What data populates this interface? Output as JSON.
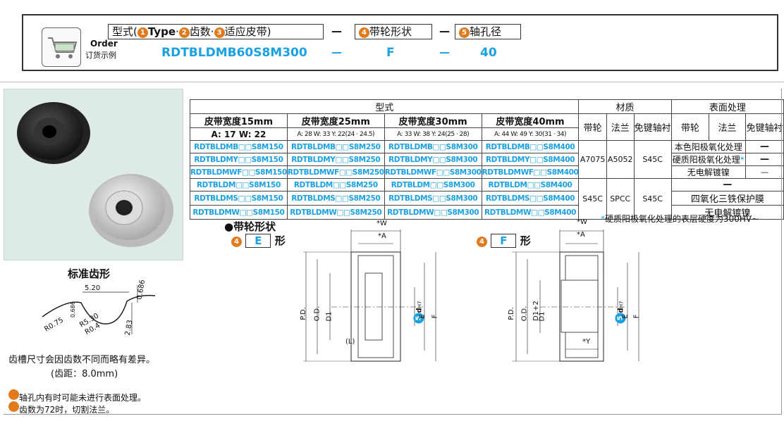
{
  "order": {
    "title_en": "Order",
    "title_cn": "订货示例",
    "type_label_prefix": "型式(",
    "type_label_type": "Type",
    "type_label_dot1": "·",
    "type_label_teeth": "齿数",
    "type_label_dot2": "·",
    "type_label_belt": "适应皮带",
    "type_label_suffix": ")",
    "shape_label": "带轮形状",
    "bore_label": "轴孔径",
    "num1": "1",
    "num2": "2",
    "num3": "3",
    "num4": "4",
    "num5": "5",
    "dash": "—",
    "example_code": "RDTBLDMB60S8M300",
    "example_shape": "F",
    "example_bore": "40"
  },
  "profile": {
    "title": "标准齿形",
    "dim_520": "5.20",
    "dim_0686a": "0.686",
    "dim_0686b": "0.686",
    "dim_r075": "R0.75",
    "dim_r530": "R5.30",
    "dim_r04": "R0.4",
    "dim_283": "2.83",
    "note1": "齿槽尺寸会因齿数不同而略有差异。",
    "note2": "(齿距：8.0mm)",
    "note3": "轴孔内有时可能未进行表面处理。",
    "note4": "齿数为72时，切割法兰。"
  },
  "table": {
    "h_type": "型式",
    "h_material": "材质",
    "h_surface": "表面处理",
    "h_w15": "皮带宽度15mm",
    "h_w25": "皮带宽度25mm",
    "h_w30": "皮带宽度30mm",
    "h_w40": "皮带宽度40mm",
    "h_pulley": "带轮",
    "h_flange": "法兰",
    "h_bushing": "免键轴衬",
    "h_pulley2": "带轮",
    "h_flange2": "法兰",
    "h_bushing2": "免键轴衬",
    "dim15": "A: 17  W: 22",
    "dim25": "A: 28  W: 33  Y: 22(24 · 24.5)",
    "dim30": "A: 33  W: 38  Y: 24(25 · 28)",
    "dim40": "A: 44  W: 49  Y: 30(31 · 34)",
    "rows": [
      [
        "RDTBLDMB□□S8M150",
        "RDTBLDMB□□S8M250",
        "RDTBLDMB□□S8M300",
        "RDTBLDMB□□S8M400"
      ],
      [
        "RDTBLDMY□□S8M150",
        "RDTBLDMY□□S8M250",
        "RDTBLDMY□□S8M300",
        "RDTBLDMY□□S8M400"
      ],
      [
        "RDTBLDMWF□□S8M150",
        "RDTBLDMWF□□S8M250",
        "RDTBLDMWF□□S8M300",
        "RDTBLDMWF□□S8M400"
      ],
      [
        "RDTBLDM□□S8M150",
        "RDTBLDM□□S8M250",
        "RDTBLDM□□S8M300",
        "RDTBLDM□□S8M400"
      ],
      [
        "RDTBLDMS□□S8M150",
        "RDTBLDMS□□S8M250",
        "RDTBLDMS□□S8M300",
        "RDTBLDMS□□S8M400"
      ],
      [
        "RDTBLDMW□□S8M150",
        "RDTBLDMW□□S8M250",
        "RDTBLDMW□□S8M300",
        "RDTBLDMW□□S8M400"
      ]
    ],
    "mat_a": {
      "pulley": "A7075",
      "flange": "A5052",
      "bushing": "S45C"
    },
    "mat_b": {
      "pulley": "S45C",
      "flange": "SPCC",
      "bushing": "S45C"
    },
    "surf1": "本色阳极氧化处理",
    "surf2": "硬质阳极氧化处理",
    "surf3": "无电解镀镍",
    "surf4": "—",
    "surf5": "四氧化三铁保护膜",
    "surf6": "无电解镀镍",
    "dashA": "—",
    "dashB": "—",
    "dashC": "—",
    "star": "*",
    "footnote": "硬质阳极氧化处理的表层硬度为300HV~"
  },
  "drawing": {
    "title": "带轮形状",
    "e_label": "E",
    "f_label": "F",
    "shape_suffix": "形",
    "w": "*W",
    "a": "*A",
    "y": "*Y",
    "pd": "P.D.",
    "od": "O.D.",
    "d1": "D1",
    "d1p2": "D1+2",
    "d_label": "d",
    "h7": "H7",
    "e": "E",
    "f": "F",
    "l": "(L)"
  }
}
